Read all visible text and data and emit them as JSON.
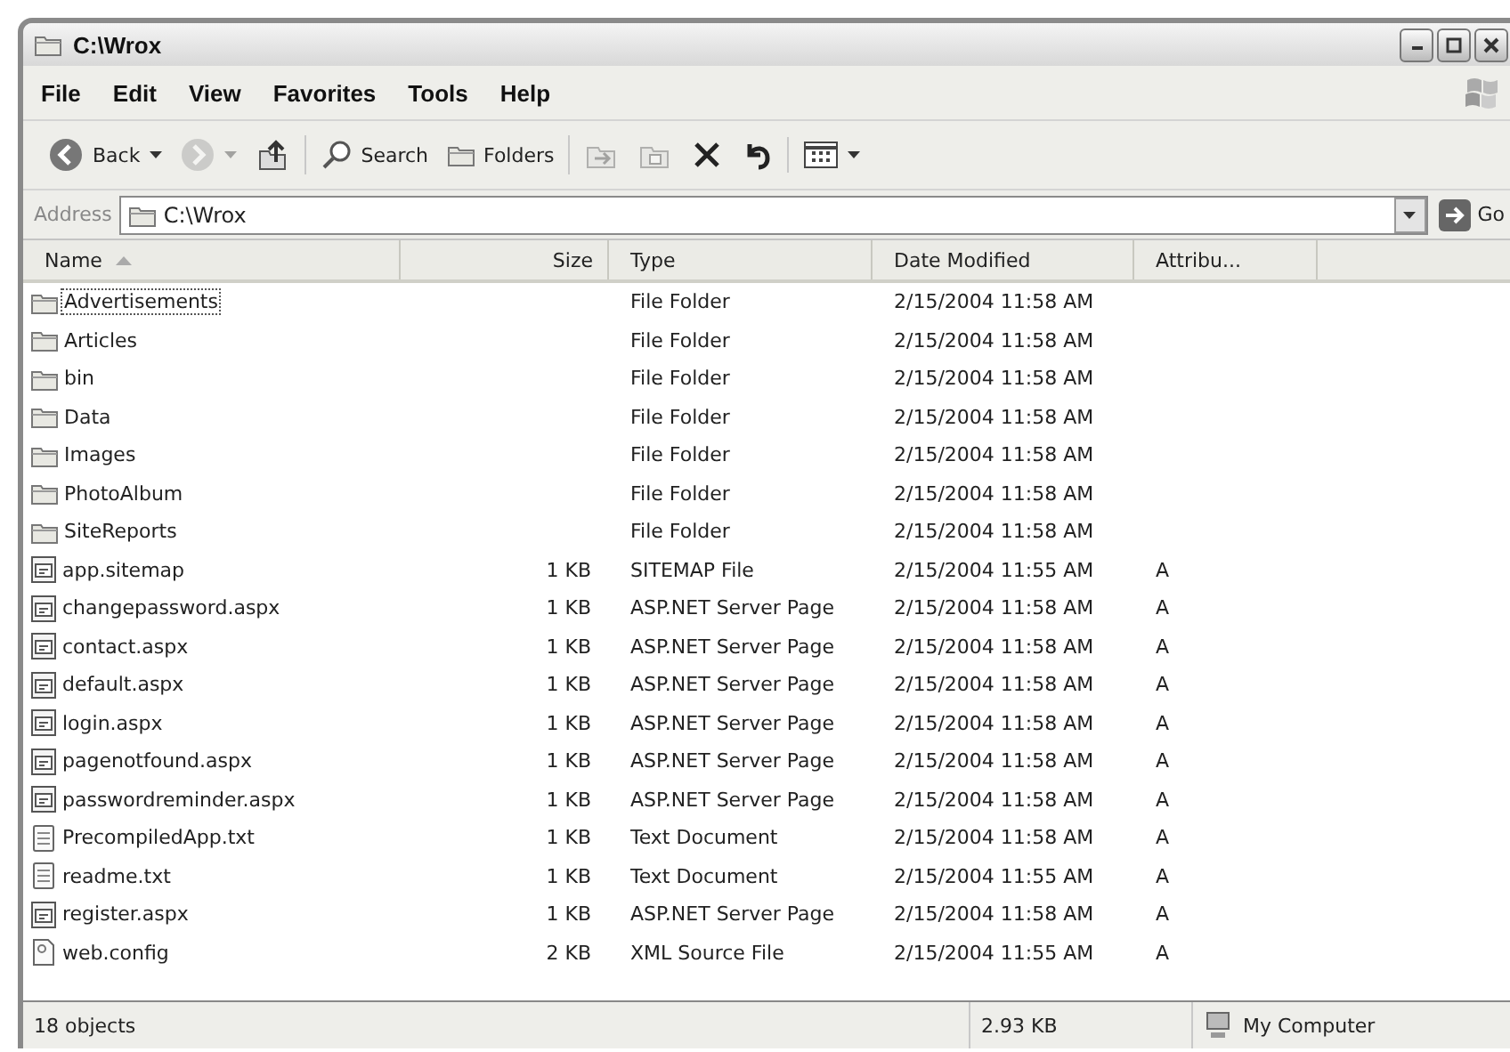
{
  "window": {
    "title": "C:\\Wrox"
  },
  "menu": [
    {
      "label": "File"
    },
    {
      "label": "Edit"
    },
    {
      "label": "View"
    },
    {
      "label": "Favorites"
    },
    {
      "label": "Tools"
    },
    {
      "label": "Help"
    }
  ],
  "toolbar": {
    "groups": [
      {
        "buttons": [
          {
            "kind": "back",
            "label": "Back",
            "dropdown": true,
            "disabled": false
          },
          {
            "kind": "forward",
            "dropdown": true,
            "disabled": true
          },
          {
            "kind": "up",
            "dropdown": false,
            "disabled": false
          }
        ]
      },
      {
        "buttons": [
          {
            "kind": "search",
            "label": "Search",
            "dropdown": false,
            "disabled": false
          },
          {
            "kind": "folders",
            "label": "Folders",
            "dropdown": false,
            "disabled": false
          }
        ]
      },
      {
        "buttons": [
          {
            "kind": "move",
            "dropdown": false,
            "disabled": true
          },
          {
            "kind": "copy",
            "dropdown": false,
            "disabled": true
          },
          {
            "kind": "delete",
            "dropdown": false,
            "disabled": false
          },
          {
            "kind": "undo",
            "dropdown": false,
            "disabled": false
          }
        ]
      },
      {
        "buttons": [
          {
            "kind": "views",
            "dropdown": true,
            "disabled": false
          }
        ]
      }
    ]
  },
  "address": {
    "label": "Address",
    "value": "C:\\Wrox",
    "go": "Go"
  },
  "columns": [
    {
      "label": "Name",
      "sorted": true
    },
    {
      "label": "Size",
      "sorted": false
    },
    {
      "label": "Type",
      "sorted": false
    },
    {
      "label": "Date Modified",
      "sorted": false
    },
    {
      "label": "Attribu...",
      "sorted": false
    }
  ],
  "rows": [
    {
      "name": "Advertisements",
      "type": "File Folder",
      "date": "2/15/2004 11:58 AM",
      "kind": "folder",
      "focused": true
    },
    {
      "name": "Articles",
      "type": "File Folder",
      "date": "2/15/2004 11:58 AM",
      "kind": "folder",
      "focused": false
    },
    {
      "name": "bin",
      "type": "File Folder",
      "date": "2/15/2004 11:58 AM",
      "kind": "folder",
      "focused": false
    },
    {
      "name": "Data",
      "type": "File Folder",
      "date": "2/15/2004 11:58 AM",
      "kind": "folder",
      "focused": false
    },
    {
      "name": "Images",
      "type": "File Folder",
      "date": "2/15/2004 11:58 AM",
      "kind": "folder",
      "focused": false
    },
    {
      "name": "PhotoAlbum",
      "type": "File Folder",
      "date": "2/15/2004 11:58 AM",
      "kind": "folder",
      "focused": false
    },
    {
      "name": "SiteReports",
      "type": "File Folder",
      "date": "2/15/2004 11:58 AM",
      "kind": "folder",
      "focused": false
    },
    {
      "name": "app.sitemap",
      "size": "1 KB",
      "type": "SITEMAP File",
      "date": "2/15/2004 11:55 AM",
      "attributes": "A",
      "kind": "page",
      "focused": false
    },
    {
      "name": "changepassword.aspx",
      "size": "1 KB",
      "type": "ASP.NET Server Page",
      "date": "2/15/2004 11:58 AM",
      "attributes": "A",
      "kind": "page",
      "focused": false
    },
    {
      "name": "contact.aspx",
      "size": "1 KB",
      "type": "ASP.NET Server Page",
      "date": "2/15/2004 11:58 AM",
      "attributes": "A",
      "kind": "page",
      "focused": false
    },
    {
      "name": "default.aspx",
      "size": "1 KB",
      "type": "ASP.NET Server Page",
      "date": "2/15/2004 11:58 AM",
      "attributes": "A",
      "kind": "page",
      "focused": false
    },
    {
      "name": "login.aspx",
      "size": "1 KB",
      "type": "ASP.NET Server Page",
      "date": "2/15/2004 11:58 AM",
      "attributes": "A",
      "kind": "page",
      "focused": false
    },
    {
      "name": "pagenotfound.aspx",
      "size": "1 KB",
      "type": "ASP.NET Server Page",
      "date": "2/15/2004 11:58 AM",
      "attributes": "A",
      "kind": "page",
      "focused": false
    },
    {
      "name": "passwordreminder.aspx",
      "size": "1 KB",
      "type": "ASP.NET Server Page",
      "date": "2/15/2004 11:58 AM",
      "attributes": "A",
      "kind": "page",
      "focused": false
    },
    {
      "name": "PrecompiledApp.txt",
      "size": "1 KB",
      "type": "Text Document",
      "date": "2/15/2004 11:58 AM",
      "attributes": "A",
      "kind": "text",
      "focused": false
    },
    {
      "name": "readme.txt",
      "size": "1 KB",
      "type": "Text Document",
      "date": "2/15/2004 11:55 AM",
      "attributes": "A",
      "kind": "text",
      "focused": false
    },
    {
      "name": "register.aspx",
      "size": "1 KB",
      "type": "ASP.NET Server Page",
      "date": "2/15/2004 11:58 AM",
      "attributes": "A",
      "kind": "page",
      "focused": false
    },
    {
      "name": "web.config",
      "size": "2 KB",
      "type": "XML Source File",
      "date": "2/15/2004 11:55 AM",
      "attributes": "A",
      "kind": "config",
      "focused": false
    }
  ],
  "status_bar": {
    "count": "18 objects",
    "size": "2.93 KB",
    "zone": "My Computer"
  }
}
